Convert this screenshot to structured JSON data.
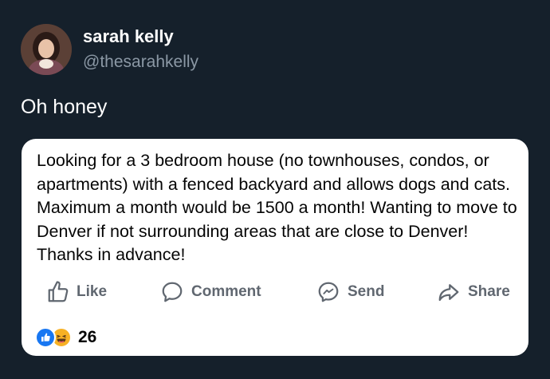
{
  "author": {
    "name": "sarah kelly",
    "handle": "@thesarahkelly",
    "avatar_icon": "profile-photo"
  },
  "tweet": {
    "text": "Oh honey"
  },
  "embedded_post": {
    "body": "Looking for a 3 bedroom house (no townhouses, condos, or apartments) with a fenced backyard and allows dogs and cats. Maximum a month would be 1500 a month! Wanting to move to Denver if not surrounding areas that are close to Denver! Thanks in advance!",
    "actions": {
      "like": "Like",
      "comment": "Comment",
      "send": "Send",
      "share": "Share"
    },
    "reactions": {
      "icons": [
        "like-icon",
        "haha-icon"
      ],
      "count": "26"
    }
  },
  "colors": {
    "background": "#15202b",
    "handle": "#8b98a5",
    "card": "#ffffff",
    "action_text": "#606770",
    "like_blue": "#1877f2",
    "haha_yellow": "#f7b125"
  }
}
